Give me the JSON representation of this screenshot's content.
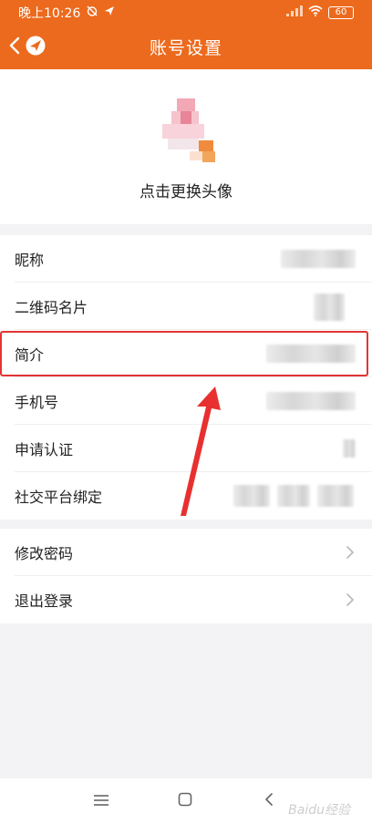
{
  "status_bar": {
    "time": "晚上10:26",
    "battery": "60"
  },
  "header": {
    "title": "账号设置"
  },
  "avatar_section": {
    "label": "点击更换头像"
  },
  "rows": [
    {
      "label": "昵称"
    },
    {
      "label": "二维码名片"
    },
    {
      "label": "简介"
    },
    {
      "label": "手机号"
    },
    {
      "label": "申请认证"
    },
    {
      "label": "社交平台绑定"
    }
  ],
  "actions": [
    {
      "label": "修改密码"
    },
    {
      "label": "退出登录"
    }
  ],
  "watermark": "Baidu经验",
  "colors": {
    "header_bg": "#ec6a1d",
    "highlight": "#e33434"
  }
}
